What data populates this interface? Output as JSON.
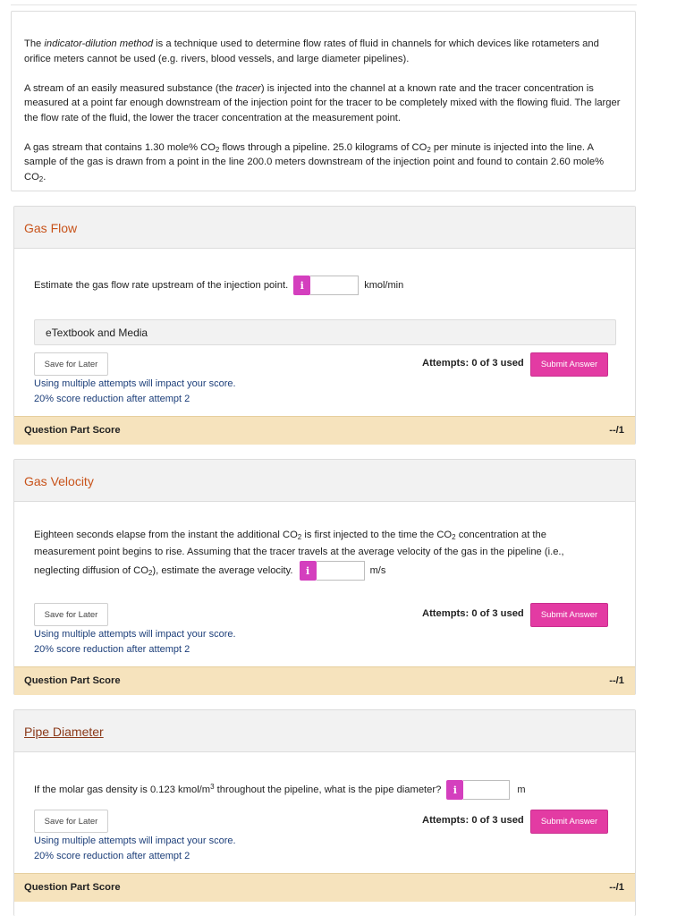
{
  "intro": {
    "p1_em": "indicator-dilution method",
    "p1_before": "The ",
    "p1_after": " is a technique used to determine flow rates of fluid in channels for which devices like rotameters and orifice meters cannot be used (e.g. rivers, blood vessels, and large diameter pipelines).",
    "p2_before": "A stream of an easily measured substance (the ",
    "p2_em": "tracer",
    "p2_after": ") is injected into the channel at a known rate and the tracer concentration is measured at a point far enough downstream of the injection point for the tracer to be completely mixed with the flowing fluid. The larger the flow rate of the fluid, the lower the tracer concentration at the measurement point.",
    "p3_a": "A gas stream that contains 1.30 mole% CO",
    "p3_b": " flows through a pipeline. 25.0 kilograms of CO",
    "p3_c": " per minute is injected into the line. A sample of the gas is drawn from a point in the line 200.0 meters downstream of the injection point and found to contain 2.60 mole% CO",
    "p3_d": ".",
    "sub2": "2"
  },
  "common": {
    "info_glyph": "i",
    "etextbook": "eTextbook and Media",
    "save_label": "Save for Later",
    "attempts": "Attempts: 0 of 3 used",
    "submit_label": "Submit Answer",
    "notice1": "Using multiple attempts will impact your score.",
    "notice2": "20% score reduction after attempt 2",
    "score_label": "Question Part Score",
    "score_value": "--/1",
    "sub2": "2",
    "sup3": "3"
  },
  "part1": {
    "title": "Gas Flow",
    "question": "Estimate the gas flow rate upstream of the injection point.",
    "answer": "",
    "unit": "kmol/min"
  },
  "part2": {
    "title": "Gas Velocity",
    "q_a": "Eighteen seconds elapse from the instant the additional CO",
    "q_b": " is first injected to the time the CO",
    "q_c": " concentration at the measurement point begins to rise. Assuming that the tracer travels at the average velocity of the gas in the pipeline (i.e., neglecting diffusion of CO",
    "q_d": "), estimate the average velocity.",
    "answer": "",
    "unit": "m/s"
  },
  "part3": {
    "title": "Pipe Diameter",
    "q_a": "If the molar gas density is 0.123 kmol/m",
    "q_b": " throughout the pipeline, what is the pipe diameter?",
    "answer": "",
    "unit": "m"
  }
}
